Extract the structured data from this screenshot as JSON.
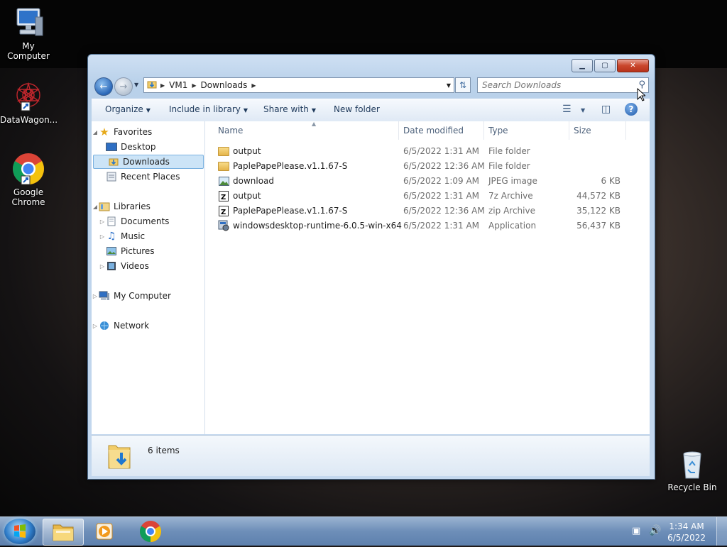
{
  "desktop": {
    "icons": [
      {
        "label": "My Computer"
      },
      {
        "label": "DataWagon..."
      },
      {
        "label": "Google Chrome"
      },
      {
        "label": "Recycle Bin"
      }
    ]
  },
  "window": {
    "caption_buttons": {
      "minimize": "▁",
      "maximize": "▢",
      "close": "✕"
    },
    "address": {
      "segments": [
        "VM1",
        "Downloads"
      ]
    },
    "search": {
      "placeholder": "Search Downloads"
    },
    "toolbar": {
      "organize": "Organize",
      "include_in_library": "Include in library",
      "share_with": "Share with",
      "new_folder": "New folder",
      "help": "?"
    },
    "nav_pane": {
      "favorites": "Favorites",
      "desktop": "Desktop",
      "downloads": "Downloads",
      "recent_places": "Recent Places",
      "libraries": "Libraries",
      "documents": "Documents",
      "music": "Music",
      "pictures": "Pictures",
      "videos": "Videos",
      "my_computer": "My Computer",
      "network": "Network"
    },
    "columns": {
      "name": "Name",
      "date_modified": "Date modified",
      "type": "Type",
      "size": "Size"
    },
    "files": [
      {
        "name": "output",
        "date": "6/5/2022 1:31 AM",
        "type": "File folder",
        "size": "",
        "icon": "folder-icon"
      },
      {
        "name": "PaplePapePlease.v1.1.67-S",
        "date": "6/5/2022 12:36 AM",
        "type": "File folder",
        "size": "",
        "icon": "folder-icon"
      },
      {
        "name": "download",
        "date": "6/5/2022 1:09 AM",
        "type": "JPEG image",
        "size": "6 KB",
        "icon": "image-file-icon"
      },
      {
        "name": "output",
        "date": "6/5/2022 1:31 AM",
        "type": "7z Archive",
        "size": "44,572 KB",
        "icon": "archive-icon"
      },
      {
        "name": "PaplePapePlease.v1.1.67-S",
        "date": "6/5/2022 12:36 AM",
        "type": "zip Archive",
        "size": "35,122 KB",
        "icon": "archive-icon"
      },
      {
        "name": "windowsdesktop-runtime-6.0.5-win-x64",
        "date": "6/5/2022 1:31 AM",
        "type": "Application",
        "size": "56,437 KB",
        "icon": "installer-icon"
      }
    ],
    "details": {
      "item_count": "6 items"
    }
  },
  "taskbar": {
    "clock_time": "1:34 AM",
    "clock_date": "6/5/2022"
  }
}
